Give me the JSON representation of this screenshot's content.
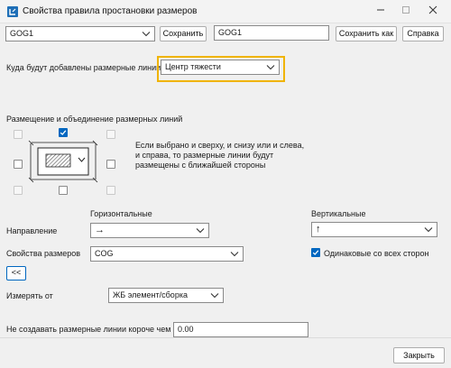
{
  "window": {
    "title": "Свойства правила простановки размеров"
  },
  "preset": {
    "selected": "GOG1",
    "name_value": "GOG1",
    "save_label": "Сохранить",
    "save_as_label": "Сохранить как",
    "help_label": "Справка"
  },
  "target": {
    "label": "Куда будут добавлены размерные линии",
    "value": "Центр тяжести"
  },
  "placement": {
    "section_label": "Размещение и объединение размерных линий",
    "hint": [
      "Если выбрано и сверху, и снизу или и слева,",
      "и справа, то размерные линии будут",
      "размещены с ближайшей стороны"
    ],
    "checkboxes": {
      "top_left": false,
      "top": true,
      "top_right": false,
      "left": false,
      "right": false,
      "bottom_left": false,
      "bottom": false,
      "bottom_right": false
    }
  },
  "direction": {
    "label": "Направление",
    "horizontal_header": "Горизонтальные",
    "vertical_header": "Вертикальные",
    "horizontal_value": "→",
    "vertical_value": "↑"
  },
  "dimension_props": {
    "label": "Свойства размеров",
    "value": "COG",
    "same_all_sides_label": "Одинаковые со всех сторон",
    "same_all_sides_checked": true
  },
  "collapse_button": "<<",
  "measure_from": {
    "label": "Измерять от",
    "value": "ЖБ элемент/сборка"
  },
  "min_length": {
    "label": "Не создавать размерные линии короче чем",
    "value": "0.00"
  },
  "footer": {
    "close_label": "Закрыть"
  },
  "colors": {
    "accent": "#0067c0",
    "highlight": "#f0b400"
  }
}
